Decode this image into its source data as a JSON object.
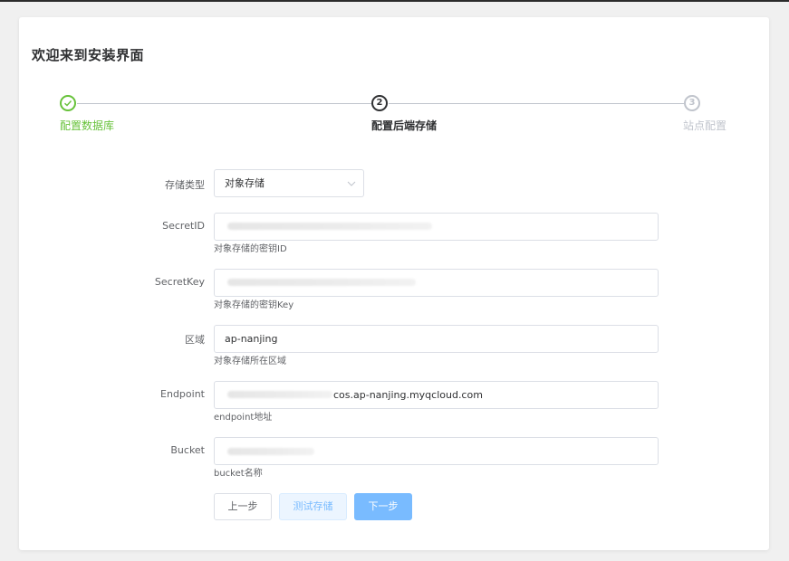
{
  "title": "欢迎来到安装界面",
  "steps": [
    {
      "label": "配置数据库",
      "status": "success",
      "number": ""
    },
    {
      "label": "配置后端存储",
      "status": "process",
      "number": "2"
    },
    {
      "label": "站点配置",
      "status": "wait",
      "number": "3"
    }
  ],
  "form": {
    "storage_type": {
      "label": "存储类型",
      "value": "对象存储"
    },
    "secret_id": {
      "label": "SecretID",
      "value": "",
      "help": "对象存储的密钥ID"
    },
    "secret_key": {
      "label": "SecretKey",
      "value": "",
      "help": "对象存储的密钥Key"
    },
    "region": {
      "label": "区域",
      "value": "ap-nanjing",
      "help": "对象存储所在区域"
    },
    "endpoint": {
      "label": "Endpoint",
      "value": "cos.ap-nanjing.myqcloud.com",
      "help": "endpoint地址"
    },
    "bucket": {
      "label": "Bucket",
      "value": "",
      "help": "bucket名称"
    }
  },
  "buttons": {
    "prev": "上一步",
    "test": "测试存储",
    "next": "下一步"
  },
  "colors": {
    "success": "#67c23a",
    "primary_light": "#79bbff",
    "wait": "#c0c4cc"
  }
}
